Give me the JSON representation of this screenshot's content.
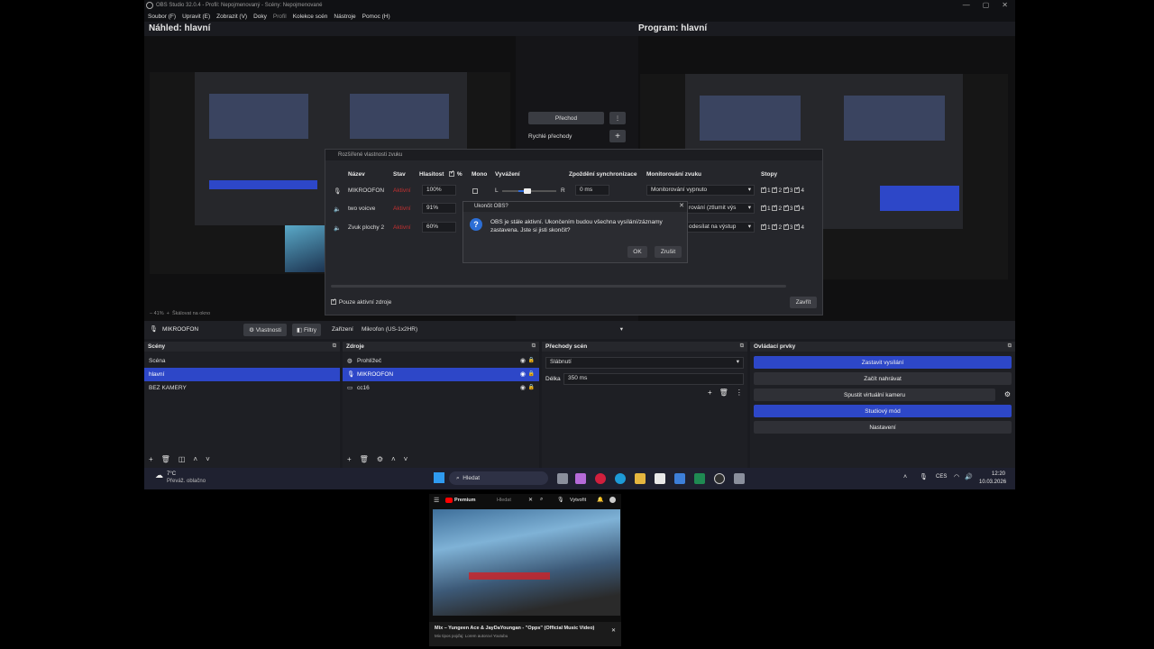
{
  "window": {
    "title": "OBS Studio 32.0.4 - Profil: Nepojmenovaný - Scény: Nepojmenované",
    "buttons": [
      "—",
      "▢",
      "✕"
    ]
  },
  "menu": [
    "Soubor (F)",
    "Upravit (E)",
    "Zobrazit (V)",
    "Doky",
    "Profil",
    "Kolekce scén",
    "Nástroje",
    "Pomoc (H)"
  ],
  "preview": {
    "label": "Náhled: hlavní",
    "zoom": "– 41%",
    "plus": "+",
    "scale_label": "Škálovat na okno"
  },
  "program": {
    "label": "Program: hlavní"
  },
  "transition": {
    "button": "Přechod",
    "quick_label": "Rychlé přechody"
  },
  "source_toolbar": {
    "source": "MIKROOFON",
    "properties": "Vlastnosti",
    "filters": "Filtry",
    "device_label": "Zařízení",
    "device_value": "Mikrofon (US-1x2HR)"
  },
  "scenes": {
    "title": "Scény",
    "items": [
      "Scéna",
      "hlavní",
      "BEZ KAMERY"
    ],
    "selected": 1
  },
  "sources": {
    "title": "Zdroje",
    "items": [
      "Prohlížeč",
      "MIKROOFON",
      "cc16"
    ],
    "selected": 1
  },
  "transitions_dock": {
    "title": "Přechody scén",
    "type": "Slábnutí",
    "duration_label": "Délka",
    "duration": "350 ms"
  },
  "controls": {
    "title": "Ovládací prvky",
    "buttons": [
      "Zastavit vysílání",
      "Začít nahrávat",
      "Spustit virtuální kameru",
      "Studiový mód",
      "Nastavení"
    ]
  },
  "audio_dialog": {
    "title": "Rozšířené vlastnosti zvuku",
    "columns": [
      "Název",
      "Stav",
      "Hlasitost",
      "%",
      "Mono",
      "Vyvážení",
      "Zpoždění synchronizace",
      "Monitorování zvuku",
      "Stopy"
    ],
    "rows": [
      {
        "name": "MIKROOFON",
        "state": "Aktivní",
        "volume": "100%",
        "sync": "0 ms",
        "monitor": "Monitorování vypnuto"
      },
      {
        "name": "two voicve",
        "state": "Aktivní",
        "volume": "91%",
        "monitor": "rování (ztlumit výs"
      },
      {
        "name": "Zvuk plochy 2",
        "state": "Aktivní",
        "volume": "60%",
        "monitor": "odesílat na výstup"
      }
    ],
    "balance_left": "L",
    "balance_right": "R",
    "tracks": [
      "1",
      "2",
      "3",
      "4"
    ],
    "active_only": "Pouze aktivní zdroje",
    "close": "Zavřít"
  },
  "exit_dialog": {
    "title": "Ukončit OBS?",
    "message": "OBS je stále aktivní. Ukončením budou všechna vysílání/záznamy zastavena. Jste si jisti skončit?",
    "ok": "OK",
    "cancel": "Zrušit"
  },
  "taskbar": {
    "weather_temp": "7°C",
    "weather_text": "Převáž. oblačno",
    "search": "Hledat",
    "lang": "CES",
    "time": "12:20",
    "date": "10.03.2026"
  },
  "youtube": {
    "brand": "Premium",
    "search": "Hledat",
    "create": "Vytvořit",
    "video_title": "Mix – Yungeen Ace & JayDaYoungan - \"Opps\" (Official Music Video)",
    "subtitle": "Mix tipos pojďaj: Lorem autorovi Youtubu"
  },
  "colors": {
    "accent": "#2d47c8",
    "window_bg": "#1a1b20",
    "dock_bg": "#1e1f24"
  }
}
